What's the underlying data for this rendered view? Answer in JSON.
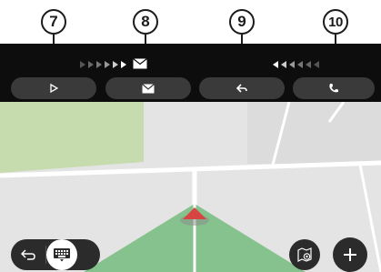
{
  "callouts": [
    {
      "label": "7"
    },
    {
      "label": "8"
    },
    {
      "label": "9"
    },
    {
      "label": "10"
    }
  ],
  "media_bar": {
    "buttons": [
      {
        "icon": "play-icon"
      },
      {
        "icon": "envelope-icon"
      },
      {
        "icon": "reply-icon"
      },
      {
        "icon": "phone-icon"
      }
    ],
    "indicators": [
      "right-arrows-icon",
      "envelope-icon",
      "left-arrows-icon"
    ]
  },
  "map_controls": {
    "back": {
      "icon": "back-arrow-icon"
    },
    "keyboard": {
      "icon": "keyboard-icon"
    },
    "map_view": {
      "icon": "map-view-icon"
    },
    "zoom_in": {
      "icon": "plus-icon"
    }
  },
  "colors": {
    "bar_bg": "#0d0d0d",
    "button_bg": "#3a3a3a",
    "map_bg": "#e4e4e4",
    "park_green": "#c6dcae",
    "route_green": "#86c28d",
    "vehicle_red": "#d64541"
  }
}
